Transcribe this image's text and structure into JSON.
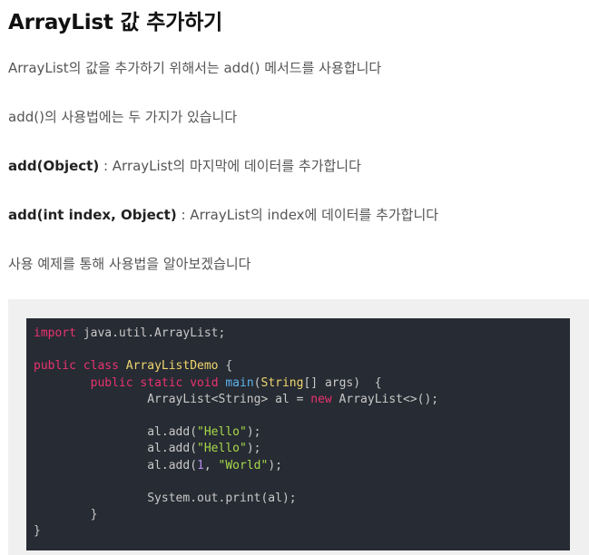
{
  "article": {
    "title": "ArrayList 값 추가하기",
    "paragraphs": {
      "p1": "ArrayList의 값을 추가하기 위해서는 add() 메서드를 사용합니다",
      "p2": "add()의 사용법에는 두 가지가 있습니다",
      "p3_bold": "add(Object)",
      "p3_rest": " : ArrayList의 마지막에 데이터를 추가합니다",
      "p4_bold": "add(int index, Object)",
      "p4_rest": " : ArrayList의 index에 데이터를 추가합니다",
      "p5": "사용 예제를 통해 사용법을 알아보겠습니다"
    }
  },
  "code": {
    "l1": {
      "kw": "import",
      "rest": " java.util.ArrayList;"
    },
    "l3": {
      "kw1": "public",
      "kw2": "class",
      "cls": "ArrayListDemo",
      "rest": " {"
    },
    "l4": {
      "indent": "        ",
      "kw1": "public",
      "kw2": "static",
      "kw3": "void",
      "fn": "main",
      "open": "(",
      "type": "String",
      "rest": "[] args)  {"
    },
    "l5": {
      "indent": "                ",
      "a": "ArrayList<String> al = ",
      "kw": "new",
      "b": " ArrayList<>();"
    },
    "l7": {
      "indent": "                ",
      "a": "al.add(",
      "str": "\"Hello\"",
      "b": ");"
    },
    "l8": {
      "indent": "                ",
      "a": "al.add(",
      "str": "\"Hello\"",
      "b": ");"
    },
    "l9": {
      "indent": "                ",
      "a": "al.add(",
      "num": "1",
      "sep": ", ",
      "str": "\"World\"",
      "b": ");"
    },
    "l11": {
      "indent": "                ",
      "a": "System.out.print(al);"
    },
    "l12": {
      "indent": "        ",
      "a": "}"
    },
    "l13": {
      "a": "}"
    }
  },
  "colors": {
    "code_background": "#272b33",
    "code_frame": "#f0f0f0",
    "keyword": "#e8336f",
    "class_name": "#f0d66d",
    "function_name": "#5fb2ec",
    "string": "#a6d94a",
    "number": "#b48cf0"
  }
}
